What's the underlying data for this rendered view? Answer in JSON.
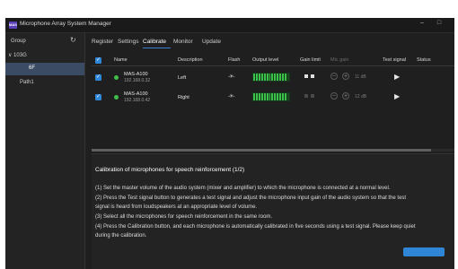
{
  "window": {
    "icon_text": "MAS",
    "title": "Microphone Array System Manager",
    "minimize": "–",
    "close": "×",
    "maximize": "□"
  },
  "sidebar": {
    "header": "Group",
    "tree": {
      "root": "∨ 103G",
      "selected": "6F",
      "path": "Path1"
    }
  },
  "tabs": [
    "Register",
    "Settings",
    "Calibrate",
    "Monitor",
    "Update"
  ],
  "active_tab": "Calibrate",
  "table": {
    "headers": {
      "name": "Name",
      "description": "Description",
      "flash": "Flash",
      "output_level": "Output level",
      "gain_limit": "Gain limit",
      "mic_gain": "Mic gain",
      "test_signal": "Test signal",
      "status": "Status"
    },
    "rows": [
      {
        "name": "MAS-A100",
        "ip": "192.168.0.32",
        "description": "Left",
        "flash": "-☀-",
        "gain": "11 dB",
        "gain_limit_color": "#e0e0e0",
        "status_color": "#3fbf4a"
      },
      {
        "name": "MAS-A100",
        "ip": "192.168.0.42",
        "description": "Right",
        "flash": "-☀-",
        "gain": "12 dB",
        "gain_limit_color": "#4a4a4a",
        "status_color": "#3fbf4a"
      }
    ],
    "level_colors": {
      "on": "#3cc24a",
      "off": "#1d4a22"
    },
    "output_level": [
      0.9,
      0.9
    ]
  },
  "panel": {
    "title": "Calibration of microphones for speech reinforcement (1/2)",
    "lines": [
      "(1) Set the master volume of the audio system (mixer and amplifier) to which the microphone is connected at a normal level.",
      "(2) Press the Test signal button to generates a test signal and adjust the microphone input gain of the audio system so that the test",
      "signal is heard from loudspeakers at an appropriate level of volume.",
      "(3) Select all the microphones for speech reinforcement in the same room.",
      "(4) Press the Calibration button, and each microphone is automatically calibrated in five seconds using a test signal. Please keep quiet",
      "during the calibration."
    ]
  },
  "accent_color": "#2f86d6"
}
